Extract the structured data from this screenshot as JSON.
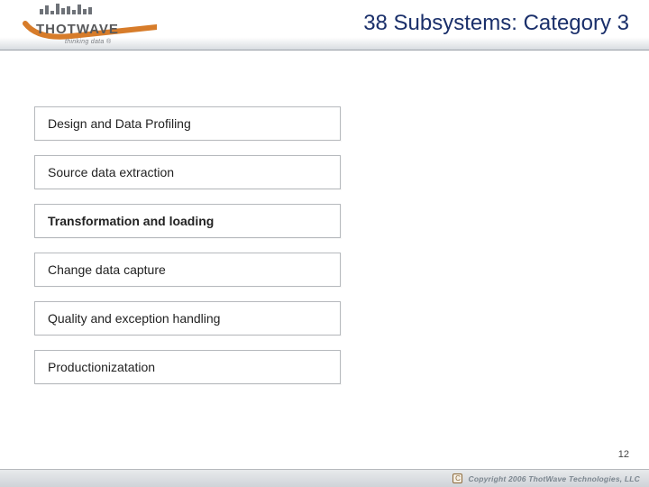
{
  "header": {
    "title": "38 Subsystems: Category 3"
  },
  "logo": {
    "brand": "THOTWAVE",
    "tagline": "thinking data ®"
  },
  "items": [
    {
      "label": "Design and Data Profiling",
      "emphasis": false
    },
    {
      "label": "Source data extraction",
      "emphasis": false
    },
    {
      "label": "Transformation and loading",
      "emphasis": true
    },
    {
      "label": "Change data capture",
      "emphasis": false
    },
    {
      "label": "Quality and exception handling",
      "emphasis": false
    },
    {
      "label": "Productionizatation",
      "emphasis": false
    }
  ],
  "footer": {
    "page_number": "12",
    "copyright_symbol": "C",
    "copyright_text": "Copyright 2006 ThotWave Technologies, LLC"
  }
}
